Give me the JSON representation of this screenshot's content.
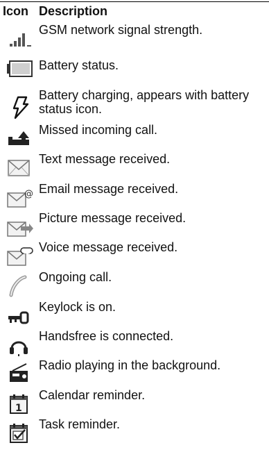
{
  "table": {
    "headers": {
      "icon": "Icon",
      "description": "Description"
    },
    "rows": [
      {
        "icon": "signal-strength-icon",
        "description": "GSM network signal strength."
      },
      {
        "icon": "battery-icon",
        "description": "Battery status."
      },
      {
        "icon": "charging-icon",
        "description": "Battery charging, appears with battery status icon."
      },
      {
        "icon": "missed-call-icon",
        "description": "Missed incoming call."
      },
      {
        "icon": "text-message-icon",
        "description": "Text message received."
      },
      {
        "icon": "email-icon",
        "description": "Email message received."
      },
      {
        "icon": "picture-message-icon",
        "description": "Picture message received."
      },
      {
        "icon": "voice-message-icon",
        "description": "Voice message received."
      },
      {
        "icon": "ongoing-call-icon",
        "description": "Ongoing call."
      },
      {
        "icon": "keylock-icon",
        "description": "Keylock is on."
      },
      {
        "icon": "handsfree-icon",
        "description": "Handsfree is connected."
      },
      {
        "icon": "radio-icon",
        "description": "Radio playing in the background."
      },
      {
        "icon": "calendar-icon",
        "description": "Calendar reminder."
      },
      {
        "icon": "task-icon",
        "description": "Task reminder."
      }
    ]
  }
}
